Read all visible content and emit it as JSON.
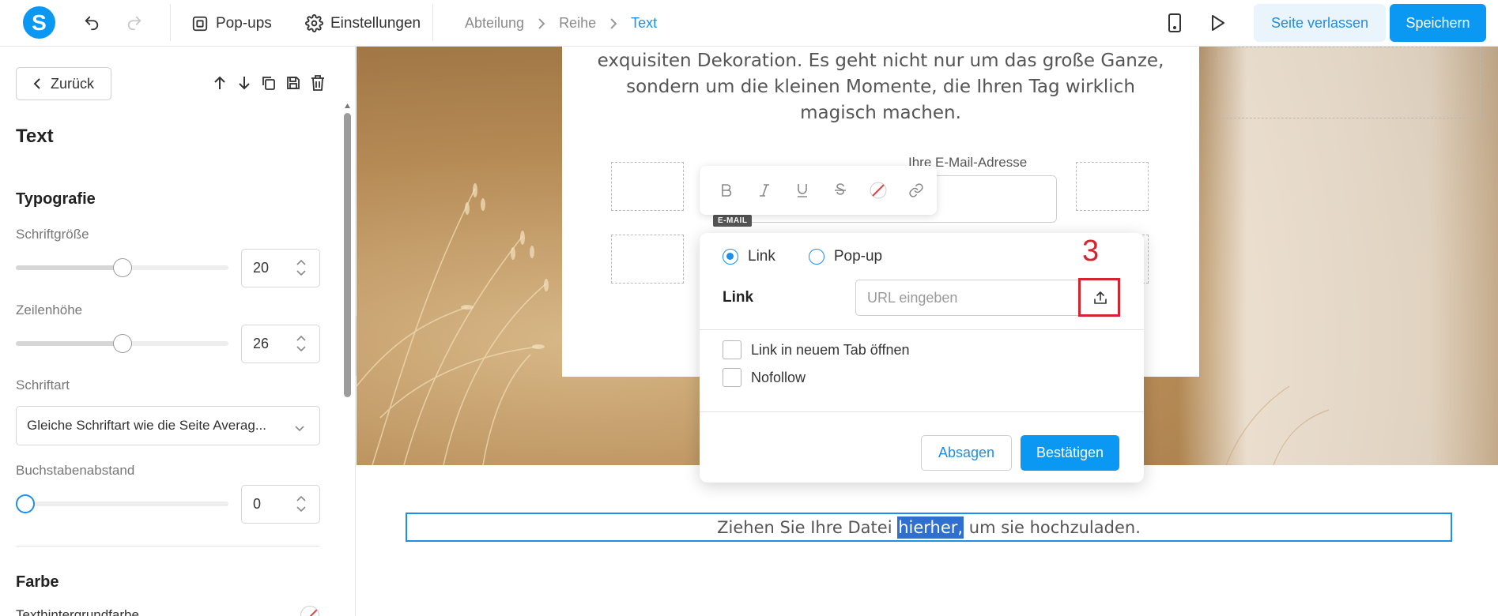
{
  "app": {
    "logo_letter": "S"
  },
  "topbar": {
    "popups_label": "Pop-ups",
    "settings_label": "Einstellungen",
    "breadcrumb": [
      "Abteilung",
      "Reihe",
      "Text"
    ],
    "leave_label": "Seite verlassen",
    "save_label": "Speichern"
  },
  "panel": {
    "back_label": "Zurück",
    "title": "Text",
    "typography_heading": "Typografie",
    "font_size": {
      "label": "Schriftgröße",
      "value": "20",
      "fraction": 0.5
    },
    "line_height": {
      "label": "Zeilenhöhe",
      "value": "26",
      "fraction": 0.5
    },
    "font_family": {
      "label": "Schriftart",
      "value": "Gleiche Schriftart wie die Seite Averag..."
    },
    "letter_spacing": {
      "label": "Buchstabenabstand",
      "value": "0",
      "fraction": 0.0
    },
    "color_heading": "Farbe",
    "partial_row_label": "Texthintergrundfarbe"
  },
  "canvas": {
    "card_text": "exquisiten Dekoration. Es geht nicht nur um das große Ganze, sondern um die kleinen Momente, die Ihren Tag wirklich magisch machen.",
    "email_label": "Ihre E-Mail-Adresse",
    "email_tag": "E-MAIL",
    "upload_text_before": "Ziehen Sie Ihre Datei ",
    "upload_text_selected": "hierher,",
    "upload_text_after": " um sie hochzuladen."
  },
  "link_dialog": {
    "radio_link": "Link",
    "radio_popup": "Pop-up",
    "selected_mode": "Link",
    "link_label": "Link",
    "url_placeholder": "URL eingeben",
    "step_number": "3",
    "new_tab_label": "Link in neuem Tab öffnen",
    "nofollow_label": "Nofollow",
    "cancel_label": "Absagen",
    "confirm_label": "Bestätigen"
  },
  "colors": {
    "accent": "#0a98f3",
    "highlight": "#d4242f",
    "selection": "#2f6fd0"
  }
}
